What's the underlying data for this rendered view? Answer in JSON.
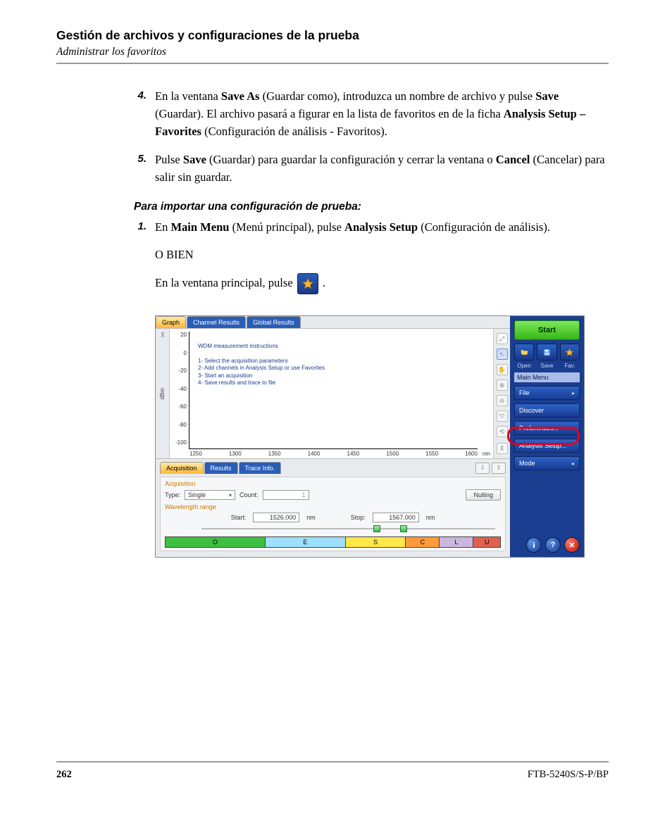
{
  "heading": "Gestión de archivos y configuraciones de la prueba",
  "subheading": "Administrar los favoritos",
  "step4": {
    "num": "4.",
    "pre1": "En la ventana ",
    "b1": "Save As",
    "mid1": " (Guardar como), introduzca un nombre de archivo y pulse ",
    "b2": "Save",
    "mid2": " (Guardar). El archivo pasará a figurar en la lista de favoritos en de la ficha ",
    "b3": "Analysis Setup – Favorites",
    "post": " (Configuración de análisis - Favoritos)."
  },
  "step5": {
    "num": "5.",
    "pre1": "Pulse ",
    "b1": "Save",
    "mid1": " (Guardar) para guardar la configuración y cerrar la ventana o ",
    "b2": "Cancel",
    "post": " (Cancelar) para salir sin guardar."
  },
  "proc_title": "Para importar una configuración de prueba:",
  "p1": {
    "num": "1.",
    "pre1": "En ",
    "b1": "Main Menu",
    "mid1": " (Menú principal), pulse ",
    "b2": "Analysis Setup",
    "post": " (Configuración de análisis).",
    "or": "O BIEN",
    "line2_pre": "En la ventana principal, pulse ",
    "line2_post": "."
  },
  "app": {
    "tabs_top": {
      "graph": "Graph",
      "channel": "Channel Results",
      "global": "Global Results"
    },
    "y_unit": "dBm",
    "yticks": [
      "20",
      "0",
      "-20",
      "-40",
      "-60",
      "-80",
      "-100"
    ],
    "xticks": [
      "1250",
      "1300",
      "1350",
      "1400",
      "1450",
      "1500",
      "1550",
      "1600"
    ],
    "x_unit": "nm",
    "instructions": {
      "title": "WDM measurement instructions",
      "l1": "1- Select the acquisition parameters",
      "l2": "2- Add channels in Analysis Setup or use Favorites",
      "l3": "3- Start an acquisition",
      "l4": "4- Save results and trace to file"
    },
    "tabs_lower": {
      "acq": "Acquisition",
      "results": "Results",
      "trace": "Trace Info."
    },
    "acq": {
      "section": "Acquisition",
      "type_label": "Type:",
      "type_value": "Single",
      "count_label": "Count:",
      "count_value": "1",
      "nulling": "Nulling",
      "wl_range": "Wavelength range",
      "start_label": "Start:",
      "start_value": "1526.000",
      "stop_label": "Stop:",
      "stop_value": "1567.000",
      "unit": "nm"
    },
    "bands": [
      {
        "label": "O",
        "color": "#3fbf3f",
        "w": 30
      },
      {
        "label": "E",
        "color": "#9fdfff",
        "w": 24
      },
      {
        "label": "S",
        "color": "#ffe74a",
        "w": 18
      },
      {
        "label": "C",
        "color": "#ff9a3a",
        "w": 10
      },
      {
        "label": "L",
        "color": "#c9b7e0",
        "w": 10
      },
      {
        "label": "U",
        "color": "#e06050",
        "w": 8
      }
    ],
    "side": {
      "start": "Start",
      "open": "Open",
      "save": "Save",
      "fav": "Fav.",
      "menu_header": "Main Menu",
      "file": "File",
      "discover": "Discover",
      "prefs": "Preferences...",
      "analysis": "Analysis Setup...",
      "mode": "Mode",
      "btn_info": "i",
      "btn_help": "?",
      "btn_close": "✕"
    }
  },
  "footer": {
    "page": "262",
    "product": "FTB-5240S/S-P/BP"
  }
}
